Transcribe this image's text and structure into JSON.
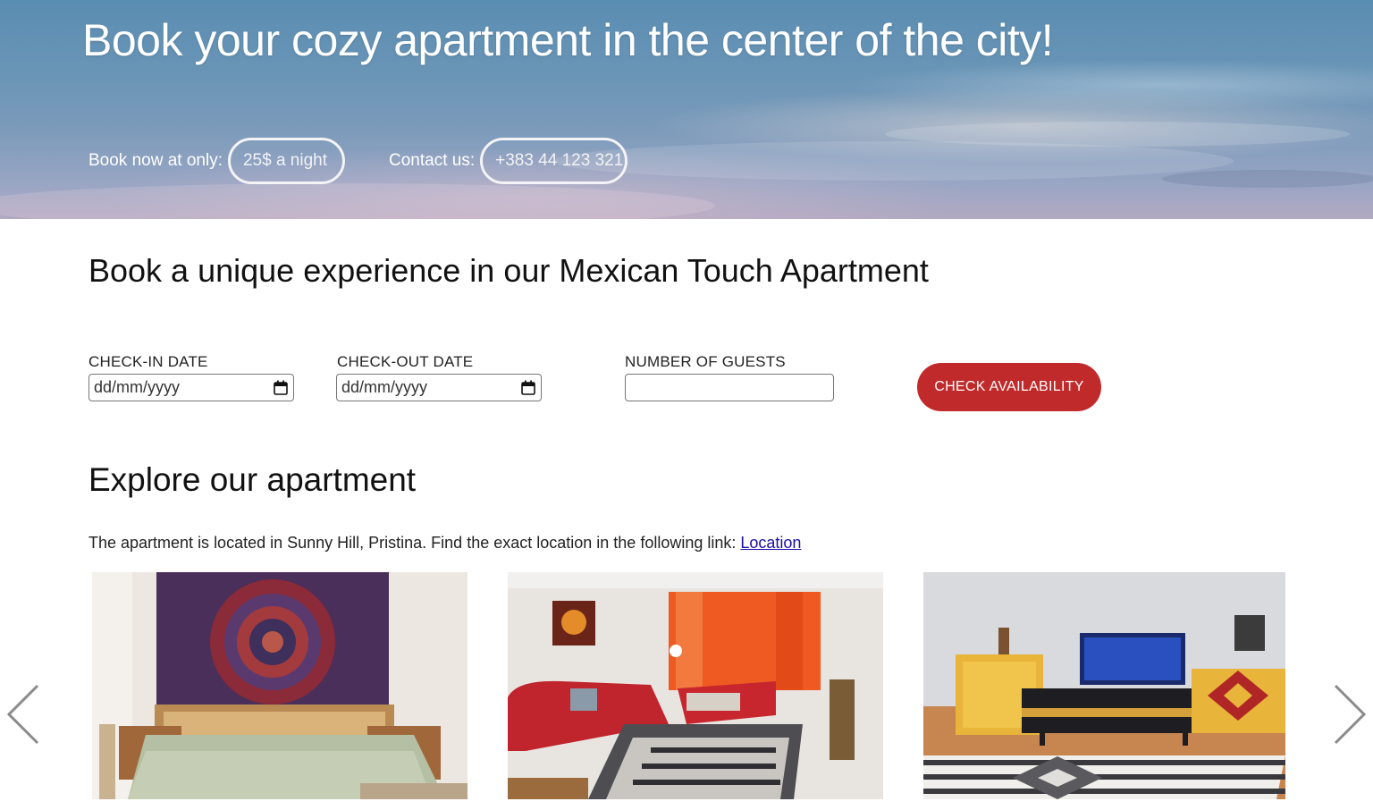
{
  "hero": {
    "title": "Book your cozy apartment in the center of the city!",
    "price_label": "Book now at only:",
    "price_value": "25$ a night",
    "contact_label": "Contact us:",
    "contact_value": "+383 44 123 321"
  },
  "booking": {
    "title": "Book a unique experience in our Mexican Touch Apartment",
    "checkin_label": "CHECK-IN DATE",
    "checkin_placeholder": "dd/mm/yyyy",
    "checkout_label": "CHECK-OUT DATE",
    "checkout_placeholder": "dd/mm/yyyy",
    "guests_label": "NUMBER OF GUESTS",
    "guests_value": "",
    "check_button": "CHECK AVAILABILITY",
    "button_color": "#c02a2a"
  },
  "explore": {
    "title": "Explore our apartment",
    "description": "The apartment is located in Sunny Hill, Pristina. Find the exact location in the following link: ",
    "link_text": "Location"
  },
  "gallery": {
    "photos": [
      "bedroom-photo",
      "living-room-photo",
      "tv-unit-photo"
    ],
    "prev_icon": "chevron-left-icon",
    "next_icon": "chevron-right-icon"
  }
}
